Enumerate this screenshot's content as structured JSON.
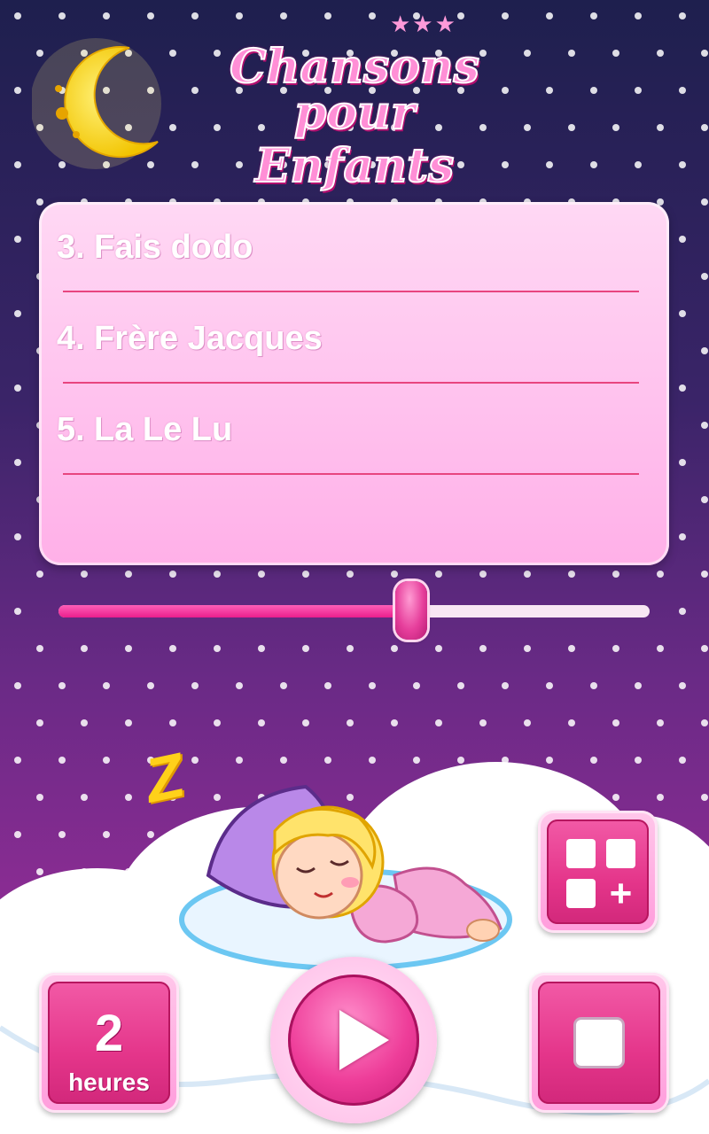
{
  "app": {
    "title_line1": "Chansons pour",
    "title_line2": "Enfants"
  },
  "playlist": {
    "songs": [
      {
        "number": "3.",
        "title": "Fais dodo"
      },
      {
        "number": "4.",
        "title": "Frère Jacques"
      },
      {
        "number": "5.",
        "title": "La Le Lu"
      }
    ]
  },
  "progress": {
    "fraction": 0.597
  },
  "controls": {
    "timer_value": "2",
    "timer_unit": "heures",
    "play_icon": "play-icon",
    "stop_icon": "stop-icon",
    "apps_icon": "add-apps-icon"
  },
  "colors": {
    "accent": "#e91e8c",
    "panel": "#ffc2ee",
    "divider": "#e8457f"
  },
  "decor": {
    "sleep_symbol": "Z"
  }
}
